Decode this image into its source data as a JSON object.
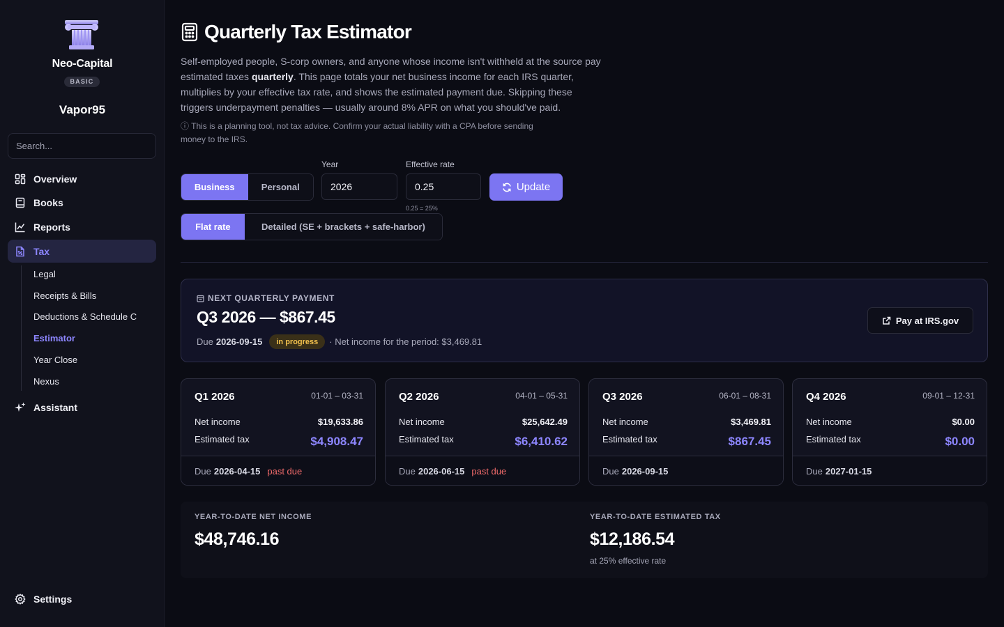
{
  "sidebar": {
    "brand": "Neo-Capital",
    "plan": "BASIC",
    "username": "Vapor95",
    "search_placeholder": "Search...",
    "nav": [
      {
        "label": "Overview",
        "icon": "grid-icon"
      },
      {
        "label": "Books",
        "icon": "book-icon"
      },
      {
        "label": "Reports",
        "icon": "chart-icon"
      },
      {
        "label": "Tax",
        "icon": "tax-document-icon",
        "active": true
      }
    ],
    "tax_sub": [
      "Legal",
      "Receipts & Bills",
      "Deductions & Schedule C",
      "Estimator",
      "Year Close",
      "Nexus"
    ],
    "assistant": "Assistant",
    "settings": "Settings"
  },
  "page": {
    "title": "Quarterly Tax Estimator",
    "desc_part1": "Self-employed people, S-corp owners, and anyone whose income isn't withheld at the source pay estimated taxes ",
    "desc_bold": "quarterly",
    "desc_part2": ". This page totals your net business income for each IRS quarter, multiplies by your effective tax rate, and shows the estimated payment due. Skipping these triggers underpayment penalties — usually around 8% APR on what you should've paid.",
    "note": "This is a planning tool, not tax advice. Confirm your actual liability with a CPA before sending money to the IRS."
  },
  "controls": {
    "type_options": [
      "Business",
      "Personal"
    ],
    "year_label": "Year",
    "year_value": "2026",
    "rate_label": "Effective rate",
    "rate_value": "0.25",
    "rate_hint": "0.25 = 25%",
    "update_label": "Update",
    "mode_options": [
      "Flat rate",
      "Detailed (SE + brackets + safe-harbor)"
    ]
  },
  "next_payment": {
    "kicker": "NEXT QUARTERLY PAYMENT",
    "title": "Q3 2026 — $867.45",
    "due_label": "Due",
    "due_date": "2026-09-15",
    "status": "in progress",
    "net_text": "· Net income for the period: $3,469.81",
    "pay_label": "Pay at IRS.gov"
  },
  "quarters": [
    {
      "title": "Q1 2026",
      "range": "01-01 – 03-31",
      "net_label": "Net income",
      "net": "$19,633.86",
      "tax_label": "Estimated tax",
      "tax": "$4,908.47",
      "due_label": "Due",
      "due": "2026-04-15",
      "status": "past due"
    },
    {
      "title": "Q2 2026",
      "range": "04-01 – 05-31",
      "net_label": "Net income",
      "net": "$25,642.49",
      "tax_label": "Estimated tax",
      "tax": "$6,410.62",
      "due_label": "Due",
      "due": "2026-06-15",
      "status": "past due"
    },
    {
      "title": "Q3 2026",
      "range": "06-01 – 08-31",
      "net_label": "Net income",
      "net": "$3,469.81",
      "tax_label": "Estimated tax",
      "tax": "$867.45",
      "due_label": "Due",
      "due": "2026-09-15",
      "status": ""
    },
    {
      "title": "Q4 2026",
      "range": "09-01 – 12-31",
      "net_label": "Net income",
      "net": "$0.00",
      "tax_label": "Estimated tax",
      "tax": "$0.00",
      "due_label": "Due",
      "due": "2027-01-15",
      "status": ""
    }
  ],
  "ytd": {
    "net_label": "YEAR-TO-DATE NET INCOME",
    "net_value": "$48,746.16",
    "tax_label": "YEAR-TO-DATE ESTIMATED TAX",
    "tax_value": "$12,186.54",
    "tax_sub": "at 25% effective rate"
  },
  "colors": {
    "accent": "#7c75f2",
    "accent_text": "#8d86ff",
    "past_due": "#f26b6b",
    "in_progress": "#f2c04d",
    "background": "#0b0c14"
  }
}
